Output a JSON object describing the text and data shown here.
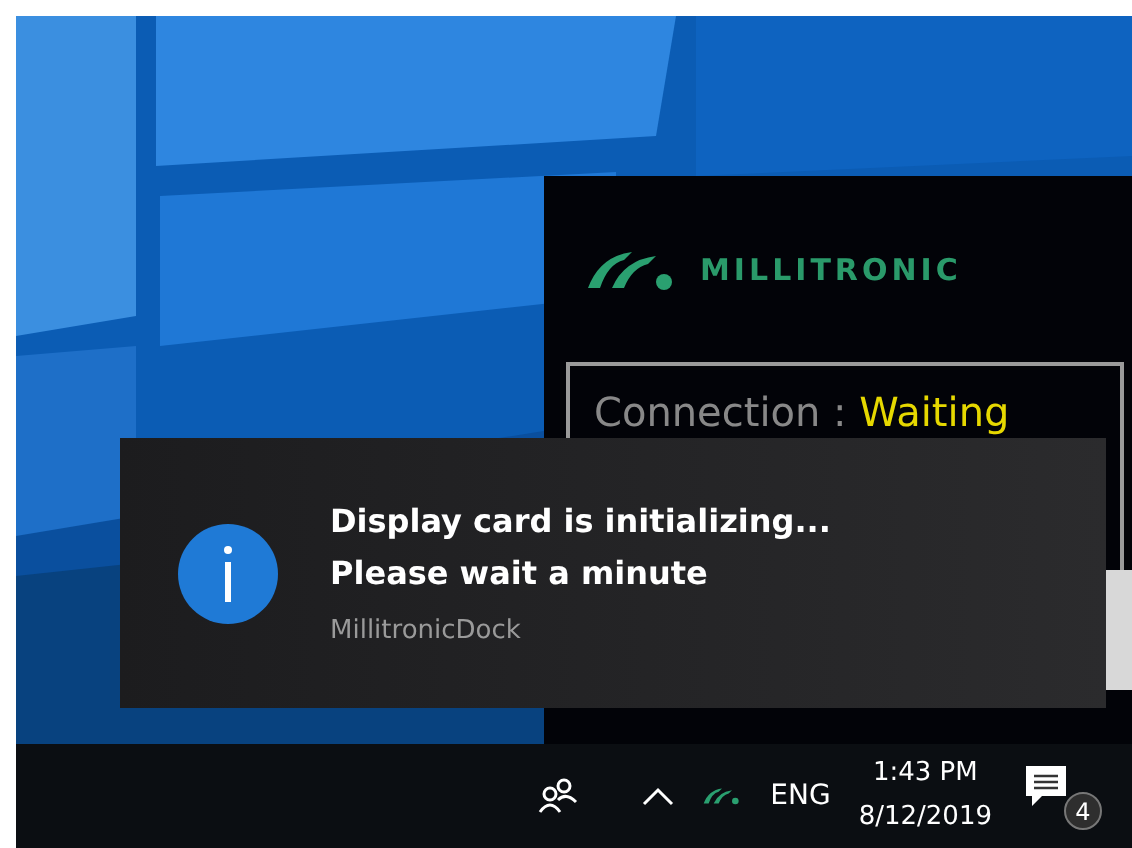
{
  "app_window": {
    "brand": "MILLITRONIC",
    "status_label": "Connection :",
    "status_value": "Waiting"
  },
  "toast": {
    "title": "Display card is initializing...",
    "message": "Please wait a minute",
    "source": "MillitronicDock"
  },
  "taskbar": {
    "language": "ENG",
    "time": "1:43 PM",
    "date": "8/12/2019",
    "notification_count": "4"
  }
}
